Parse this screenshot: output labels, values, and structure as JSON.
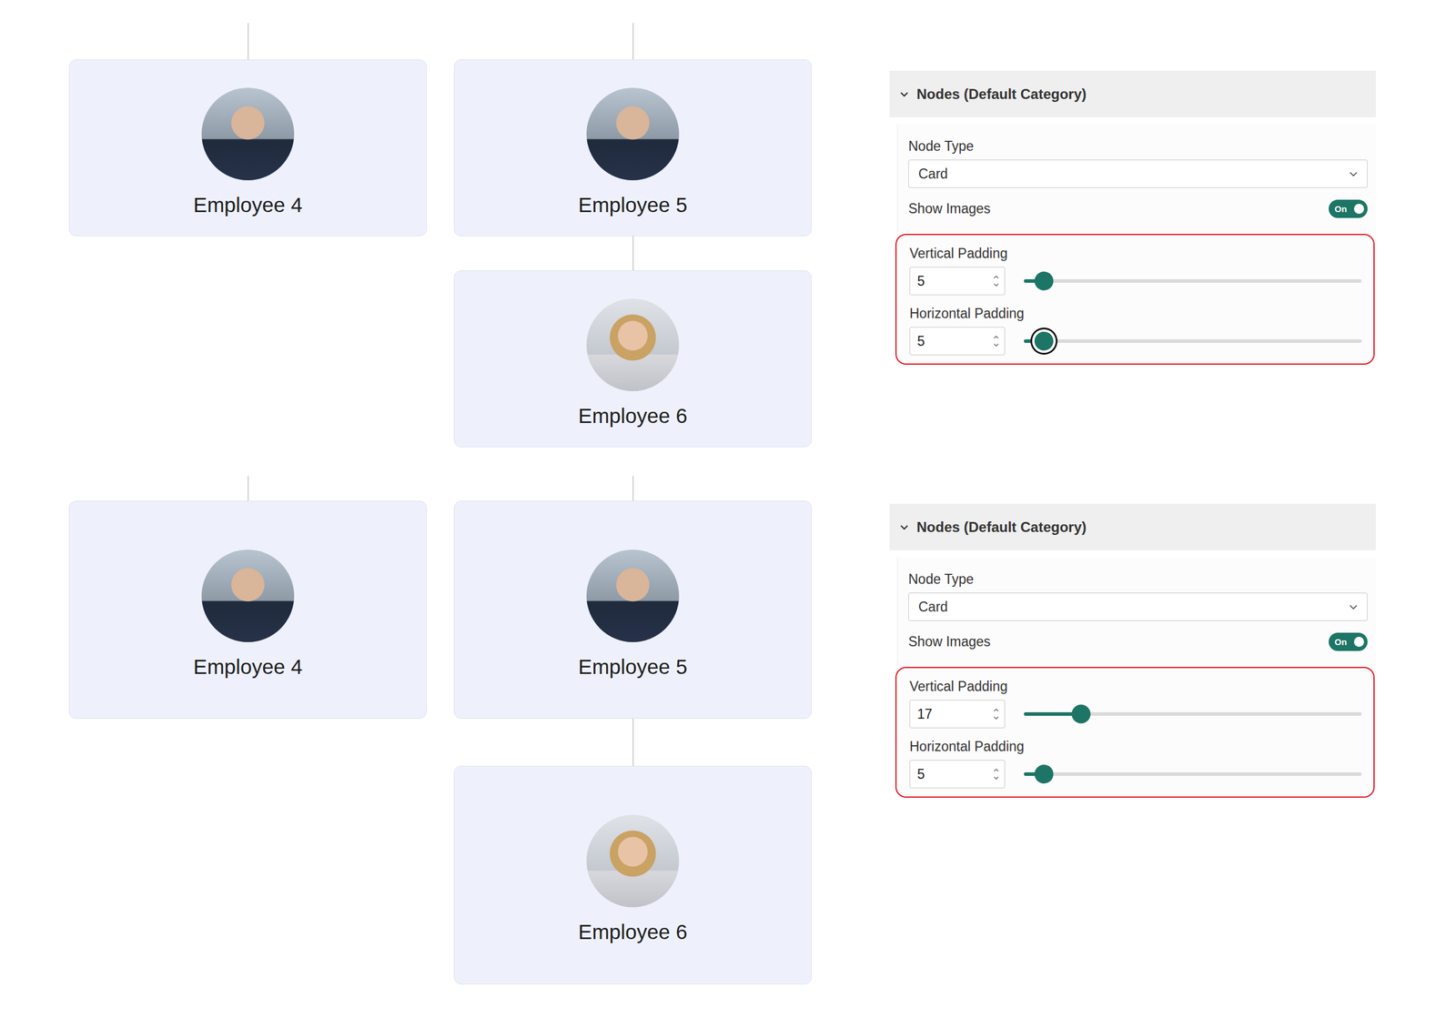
{
  "scenes": [
    {
      "org_chart": {
        "nodes": [
          {
            "name": "Employee 4",
            "children": []
          },
          {
            "name": "Employee 5",
            "children": [
              {
                "name": "Employee 6",
                "children": []
              }
            ]
          }
        ]
      },
      "settings": {
        "header": "Nodes (Default Category)",
        "expanded": true,
        "node_type": {
          "label": "Node Type",
          "value": "Card"
        },
        "show_images": {
          "label": "Show Images",
          "on": true,
          "text": "On"
        },
        "highlighted": true,
        "sliders": [
          {
            "label": "Vertical Padding",
            "value": "5",
            "level": 0.06,
            "focused": false
          },
          {
            "label": "Horizontal Padding",
            "value": "5",
            "level": 0.06,
            "focused": true
          }
        ]
      }
    },
    {
      "org_chart": {
        "nodes": [
          {
            "name": "Employee 4",
            "children": []
          },
          {
            "name": "Employee 5",
            "children": [
              {
                "name": "Employee 6",
                "children": []
              }
            ]
          }
        ]
      },
      "settings": {
        "header": "Nodes (Default Category)",
        "expanded": true,
        "node_type": {
          "label": "Node Type",
          "value": "Card"
        },
        "show_images": {
          "label": "Show Images",
          "on": true,
          "text": "On"
        },
        "highlighted": true,
        "sliders": [
          {
            "label": "Vertical Padding",
            "value": "17",
            "level": 0.17,
            "focused": false
          },
          {
            "label": "Horizontal Padding",
            "value": "5",
            "level": 0.06,
            "focused": false
          }
        ]
      }
    }
  ]
}
